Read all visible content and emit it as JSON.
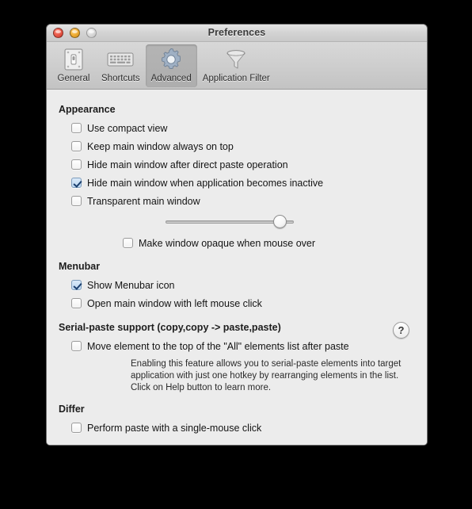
{
  "window": {
    "title": "Preferences",
    "traffic_lights": [
      {
        "name": "close",
        "color": "#ec5f4e"
      },
      {
        "name": "minimize",
        "color": "#f2b23c"
      },
      {
        "name": "zoom",
        "color": "#dcdcdc"
      }
    ]
  },
  "toolbar": {
    "items": [
      {
        "label": "General",
        "icon": "switch-plate-icon",
        "selected": false
      },
      {
        "label": "Shortcuts",
        "icon": "keyboard-icon",
        "selected": false
      },
      {
        "label": "Advanced",
        "icon": "gear-icon",
        "selected": true
      },
      {
        "label": "Application Filter",
        "icon": "funnel-icon",
        "selected": false
      }
    ]
  },
  "sections": {
    "appearance": {
      "title": "Appearance",
      "options": [
        {
          "label": "Use compact view",
          "checked": false
        },
        {
          "label": "Keep main window always on top",
          "checked": false
        },
        {
          "label": "Hide main window after direct paste operation",
          "checked": false
        },
        {
          "label": "Hide main window when application becomes inactive",
          "checked": true
        },
        {
          "label": "Transparent main window",
          "checked": false
        }
      ],
      "slider": {
        "value": 94,
        "min": 0,
        "max": 100
      },
      "opaque_option": {
        "label": "Make window opaque when mouse over",
        "checked": false
      }
    },
    "menubar": {
      "title": "Menubar",
      "options": [
        {
          "label": "Show Menubar icon",
          "checked": true
        },
        {
          "label": "Open main window with left mouse click",
          "checked": false
        }
      ]
    },
    "serial_paste": {
      "title": "Serial-paste support (copy,copy -> paste,paste)",
      "help_label": "?",
      "options": [
        {
          "label": "Move element to the top of the \"All\" elements list after paste",
          "checked": false
        }
      ],
      "description_line1": "Enabling this feature allows you to serial-paste elements into target",
      "description_line2": "application with just one hotkey by rearranging elements in the list.",
      "description_line3": "Click on Help button to learn more."
    },
    "differ": {
      "title": "Differ",
      "options": [
        {
          "label": "Perform paste with a single-mouse click",
          "checked": false
        }
      ]
    }
  }
}
